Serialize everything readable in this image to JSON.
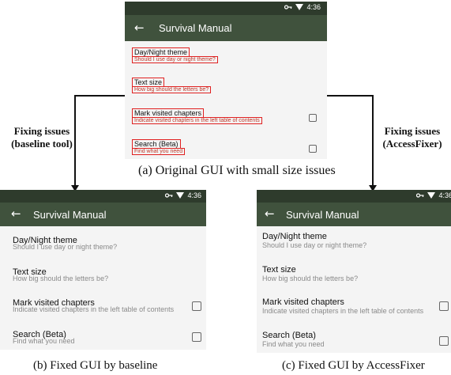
{
  "app": {
    "time": "4:36",
    "title": "Survival Manual",
    "back_glyph": "←",
    "status_icons": [
      "key-icon",
      "wifi-icon"
    ],
    "colors": {
      "status_bar": "#2e3b2c",
      "app_bar": "#40523d",
      "highlight": "#e02020"
    }
  },
  "settings": [
    {
      "title": "Day/Night theme",
      "subtitle": "Should I use day or night theme?",
      "has_checkbox": false
    },
    {
      "title": "Text size",
      "subtitle": "How big should the letters be?",
      "has_checkbox": false
    },
    {
      "title": "Mark visited chapters",
      "subtitle": "Indicate visited chapters in the left table of contents",
      "has_checkbox": true,
      "checked": false
    },
    {
      "title": "Search (Beta)",
      "subtitle": "Find what you need",
      "has_checkbox": true,
      "checked": false
    }
  ],
  "labels": {
    "left": {
      "line1": "Fixing issues",
      "line2": "(baseline tool)"
    },
    "right": {
      "line1": "Fixing issues",
      "line2": "(AccessFixer)"
    }
  },
  "captions": {
    "a": "(a) Original GUI with small size issues",
    "b": "(b) Fixed GUI by baseline",
    "c": "(c) Fixed GUI by AccessFixer"
  }
}
